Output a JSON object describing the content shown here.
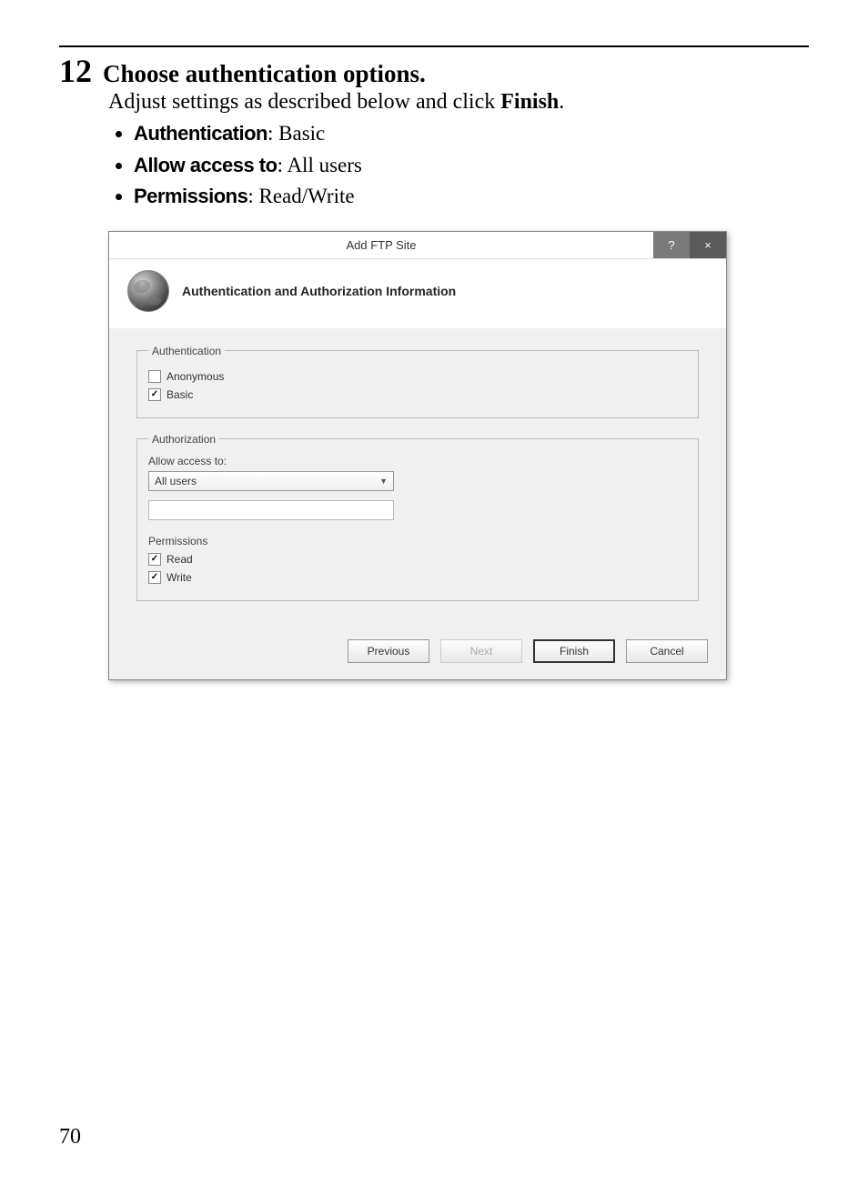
{
  "step": {
    "number": "12",
    "title": "Choose authentication options.",
    "description_prefix": "Adjust settings as described below and click ",
    "description_bold": "Finish",
    "description_suffix": ".",
    "bullets": [
      {
        "label": "Authentication",
        "value": ": Basic"
      },
      {
        "label": "Allow access to",
        "value": ": All users"
      },
      {
        "label": "Permissions",
        "value": ": Read/Write"
      }
    ]
  },
  "dialog": {
    "title": "Add FTP Site",
    "help_symbol": "?",
    "close_symbol": "×",
    "header_title": "Authentication and Authorization Information",
    "authentication": {
      "legend": "Authentication",
      "anonymous": {
        "label": "Anonymous",
        "checked": false
      },
      "basic": {
        "label": "Basic",
        "checked": true
      }
    },
    "authorization": {
      "legend": "Authorization",
      "allow_label": "Allow access to:",
      "select_value": "All users",
      "permissions_label": "Permissions",
      "read": {
        "label": "Read",
        "checked": true
      },
      "write": {
        "label": "Write",
        "checked": true
      }
    },
    "buttons": {
      "previous": "Previous",
      "next": "Next",
      "finish": "Finish",
      "cancel": "Cancel"
    }
  },
  "page_number": "70"
}
